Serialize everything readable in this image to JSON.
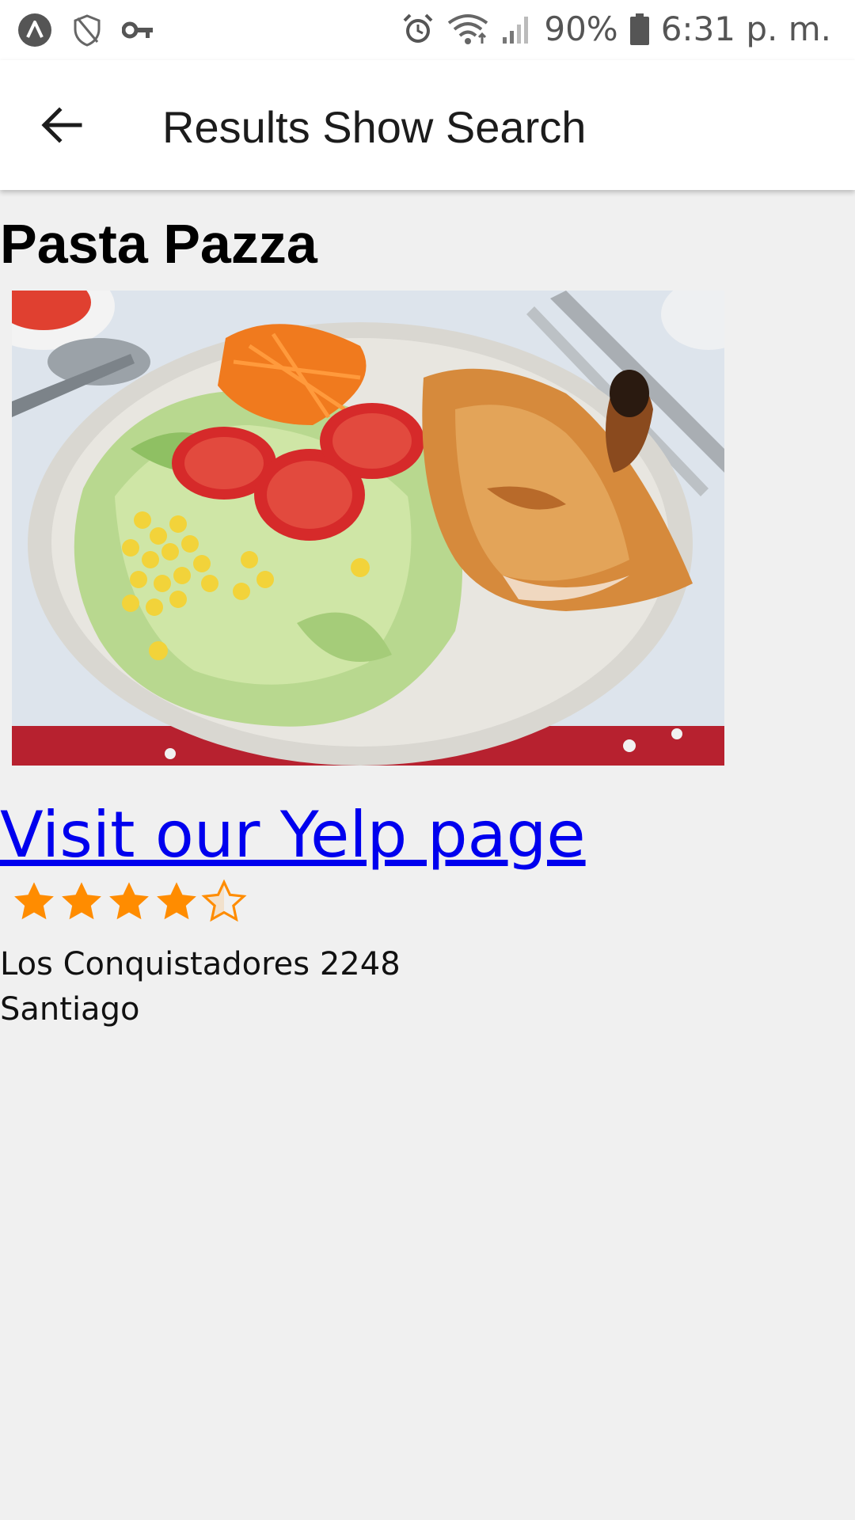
{
  "status_bar": {
    "battery": "90%",
    "time": "6:31 p. m.",
    "icons": [
      "app-logo-icon",
      "shield-icon",
      "key-icon",
      "alarm-icon",
      "wifi-icon",
      "signal-icon",
      "battery-icon"
    ]
  },
  "app_bar": {
    "title": "Results Show Search",
    "back_icon": "arrow-back-icon"
  },
  "restaurant": {
    "name": "Pasta Pazza",
    "photo_description_icon": "food-photo",
    "link_label": "Visit our Yelp page",
    "rating": 4.5,
    "rating_max": 5,
    "address_line1": "Los Conquistadores 2248",
    "address_line2": "Santiago"
  },
  "colors": {
    "link": "#0000ee",
    "star": "#ff8c00",
    "background": "#f0f0f0"
  }
}
